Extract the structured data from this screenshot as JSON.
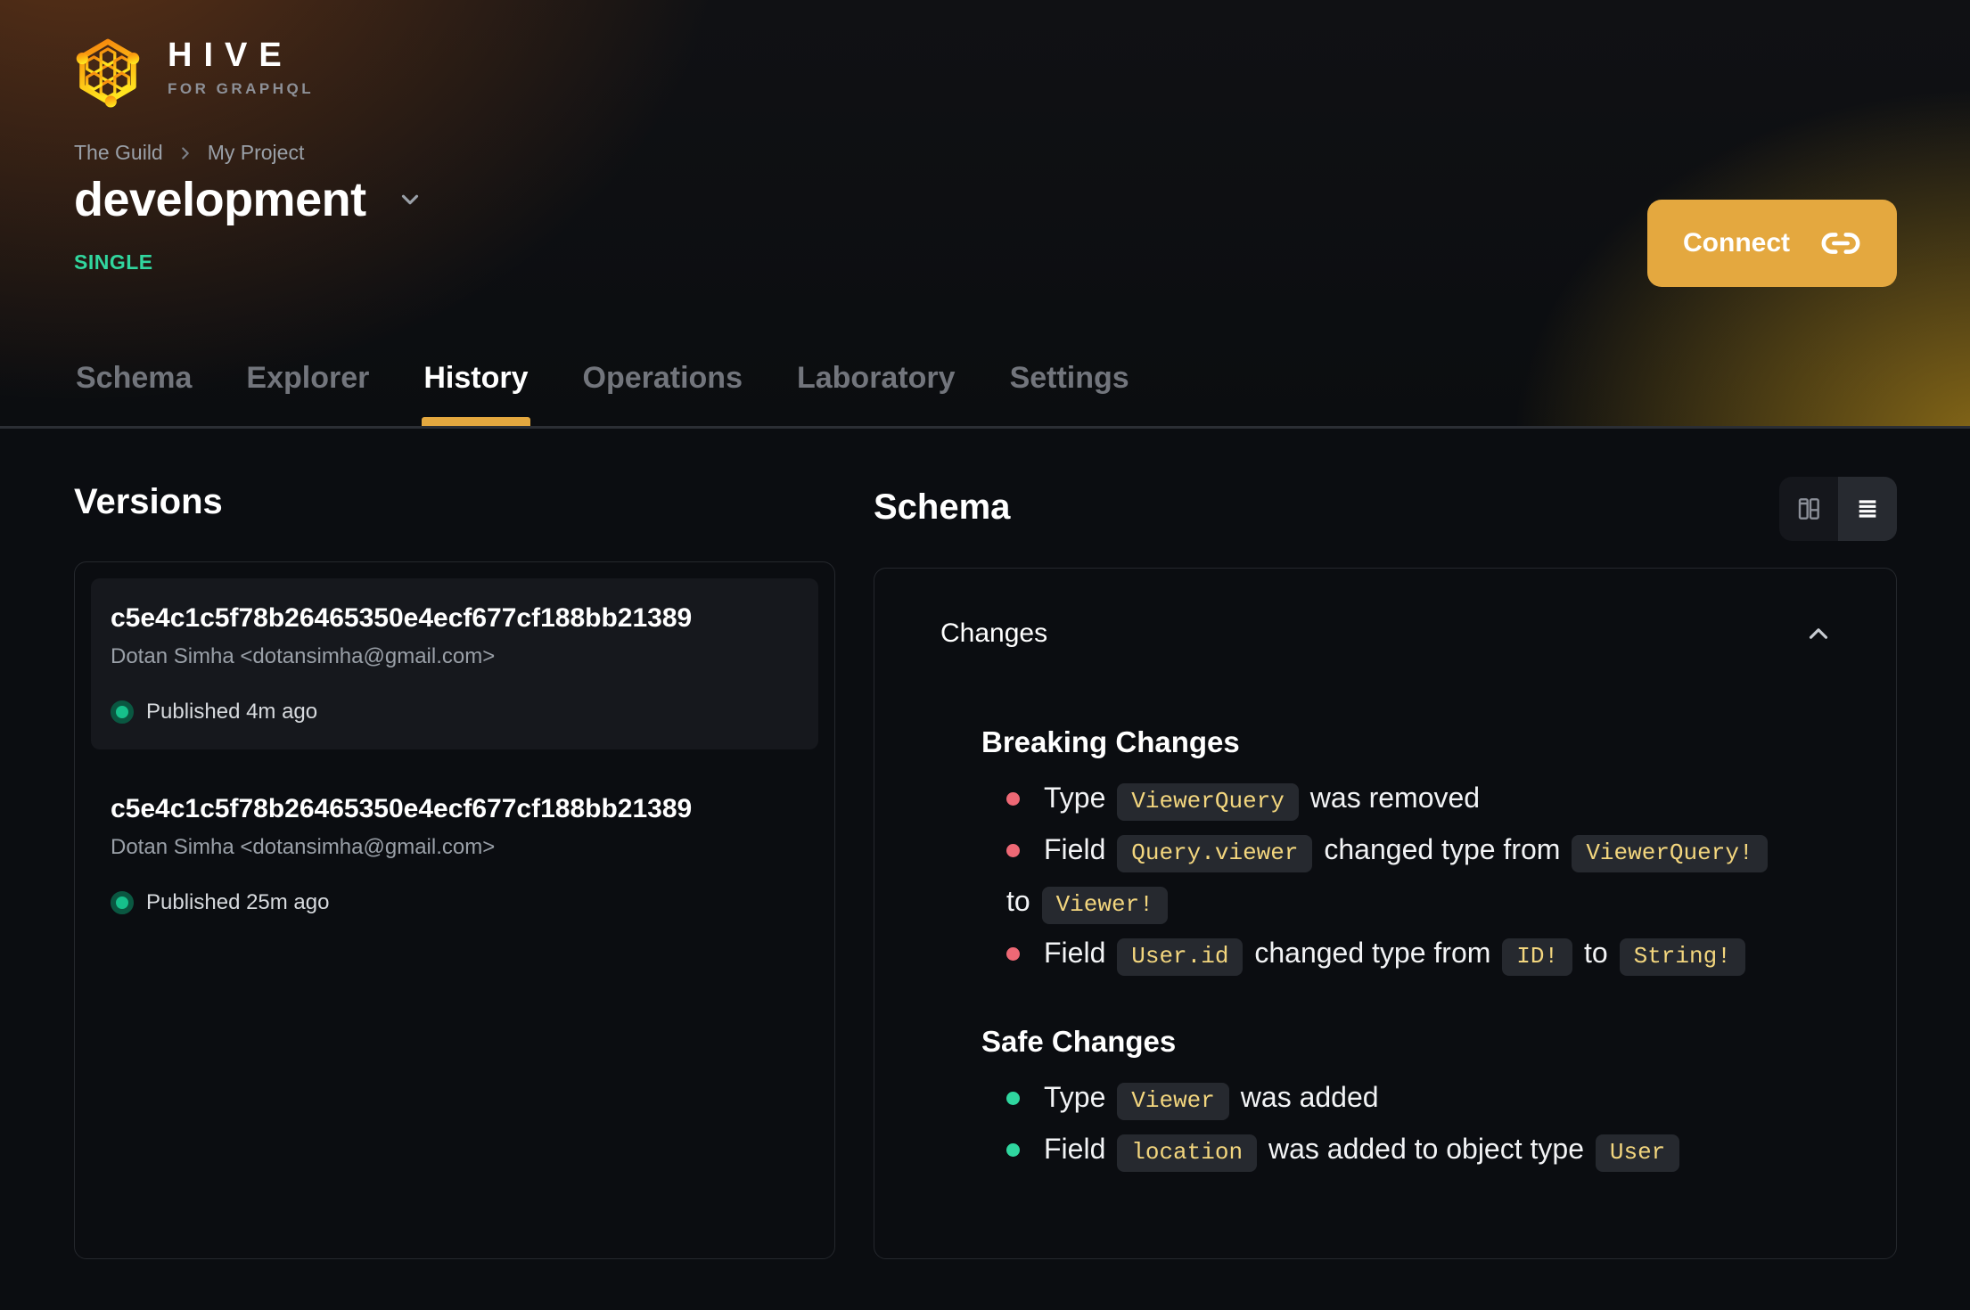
{
  "brand": {
    "name": "HIVE",
    "tagline": "FOR GRAPHQL"
  },
  "breadcrumb": {
    "items": [
      "The Guild",
      "My Project"
    ]
  },
  "target": {
    "name": "development",
    "type_badge": "SINGLE"
  },
  "header_actions": {
    "connect_label": "Connect"
  },
  "tabs": [
    {
      "label": "Schema",
      "active": false
    },
    {
      "label": "Explorer",
      "active": false
    },
    {
      "label": "History",
      "active": true
    },
    {
      "label": "Operations",
      "active": false
    },
    {
      "label": "Laboratory",
      "active": false
    },
    {
      "label": "Settings",
      "active": false
    }
  ],
  "versions": {
    "heading": "Versions",
    "items": [
      {
        "hash": "c5e4c1c5f78b26465350e4ecf677cf188bb21389",
        "author": "Dotan Simha <dotansimha@gmail.com>",
        "status": "Published 4m ago",
        "selected": true
      },
      {
        "hash": "c5e4c1c5f78b26465350e4ecf677cf188bb21389",
        "author": "Dotan Simha <dotansimha@gmail.com>",
        "status": "Published 25m ago",
        "selected": false
      }
    ]
  },
  "schema_view": {
    "heading": "Schema",
    "view_toggle": {
      "options": [
        "split-view",
        "list-view"
      ],
      "active": "list-view"
    },
    "panel": {
      "title": "Changes",
      "collapsed": false,
      "sections": [
        {
          "kind": "breaking",
          "heading": "Breaking Changes",
          "items": [
            {
              "segments": [
                [
                  "text",
                  "Type "
                ],
                [
                  "code",
                  "ViewerQuery"
                ],
                [
                  "text",
                  " was removed"
                ]
              ]
            },
            {
              "segments": [
                [
                  "text",
                  "Field "
                ],
                [
                  "code",
                  "Query.viewer"
                ],
                [
                  "text",
                  " changed type from "
                ],
                [
                  "code",
                  "ViewerQuery!"
                ],
                [
                  "br",
                  ""
                ],
                [
                  "text",
                  "to "
                ],
                [
                  "code",
                  "Viewer!"
                ]
              ]
            },
            {
              "segments": [
                [
                  "text",
                  "Field "
                ],
                [
                  "code",
                  "User.id"
                ],
                [
                  "text",
                  " changed type from "
                ],
                [
                  "code",
                  "ID!"
                ],
                [
                  "text",
                  " to "
                ],
                [
                  "code",
                  "String!"
                ]
              ]
            }
          ]
        },
        {
          "kind": "safe",
          "heading": "Safe Changes",
          "items": [
            {
              "segments": [
                [
                  "text",
                  "Type "
                ],
                [
                  "code",
                  "Viewer"
                ],
                [
                  "text",
                  " was added"
                ]
              ]
            },
            {
              "segments": [
                [
                  "text",
                  "Field "
                ],
                [
                  "code",
                  "location"
                ],
                [
                  "text",
                  " was added to object type "
                ],
                [
                  "code",
                  "User"
                ]
              ]
            }
          ]
        }
      ]
    }
  },
  "icons": [
    "hive-logo-icon",
    "chevron-right-icon",
    "chevron-down-icon",
    "link-icon",
    "split-view-icon",
    "list-view-icon",
    "chevron-up-icon",
    "published-dot",
    "breaking-bullet-dot",
    "safe-bullet-dot"
  ],
  "colors": {
    "accent": "#e4a83f",
    "badge_green": "#31d69e",
    "breaking_bullet": "#ee6875",
    "safe_bullet": "#2fd69f",
    "code_text": "#f3d67e",
    "published_dot": "#16c08b"
  }
}
